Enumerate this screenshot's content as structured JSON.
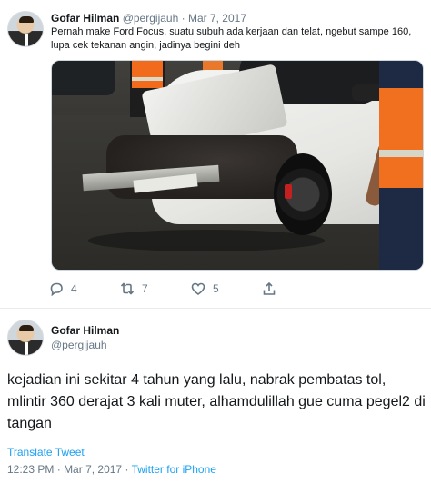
{
  "tweet1": {
    "author_name": "Gofar Hilman",
    "handle": "@pergijauh",
    "separator": "·",
    "date": "Mar 7, 2017",
    "text": "Pernah make Ford Focus, suatu subuh ada kerjaan dan telat, ngebut sampe 160, lupa cek tekanan angin, jadinya begini deh",
    "actions": {
      "reply_count": "4",
      "retweet_count": "7",
      "like_count": "5"
    }
  },
  "tweet2": {
    "author_name": "Gofar Hilman",
    "handle": "@pergijauh",
    "text": "kejadian ini sekitar 4 tahun yang lalu, nabrak pembatas tol, mlintir 360 derajat 3 kali muter, alhamdulillah gue cuma pegel2 di tangan",
    "translate_label": "Translate Tweet",
    "time": "12:23 PM",
    "date": "Mar 7, 2017",
    "separator": "·",
    "source": "Twitter for iPhone"
  },
  "colors": {
    "link": "#1da1f2",
    "muted": "#657786",
    "text": "#14171a",
    "divider": "#e6ecf0"
  },
  "icons": [
    "reply-icon",
    "retweet-icon",
    "like-icon",
    "share-icon"
  ]
}
